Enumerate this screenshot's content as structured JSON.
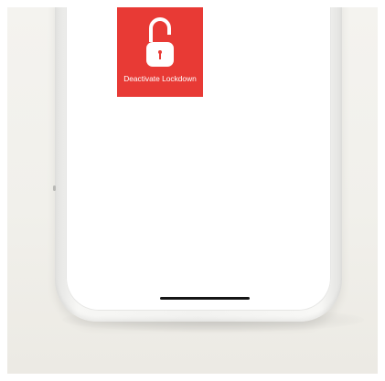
{
  "lockdown_tile": {
    "label": "Deactivate Lockdown",
    "icon": "unlocked-padlock-icon",
    "background_color": "#e83a35"
  },
  "device": {
    "home_indicator": "home-indicator"
  }
}
